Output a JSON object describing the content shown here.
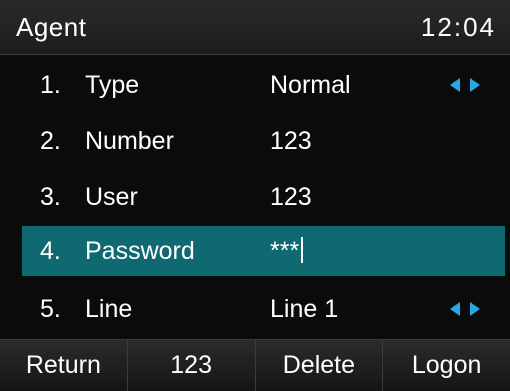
{
  "header": {
    "title": "Agent",
    "time": "12:04"
  },
  "items": [
    {
      "num": "1.",
      "label": "Type",
      "value": "Normal",
      "has_arrows": true,
      "selected": false
    },
    {
      "num": "2.",
      "label": "Number",
      "value": "123",
      "has_arrows": false,
      "selected": false
    },
    {
      "num": "3.",
      "label": "User",
      "value": "123",
      "has_arrows": false,
      "selected": false
    },
    {
      "num": "4.",
      "label": "Password",
      "value": "***",
      "has_arrows": false,
      "selected": true
    },
    {
      "num": "5.",
      "label": "Line",
      "value": "Line 1",
      "has_arrows": true,
      "selected": false
    }
  ],
  "softkeys": [
    "Return",
    "123",
    "Delete",
    "Logon"
  ],
  "colors": {
    "accent": "#0e6a70",
    "arrow": "#2aa7e0",
    "background": "#0b0b0b"
  },
  "icons": {
    "selector_arrows": "left-right-arrows-icon"
  }
}
